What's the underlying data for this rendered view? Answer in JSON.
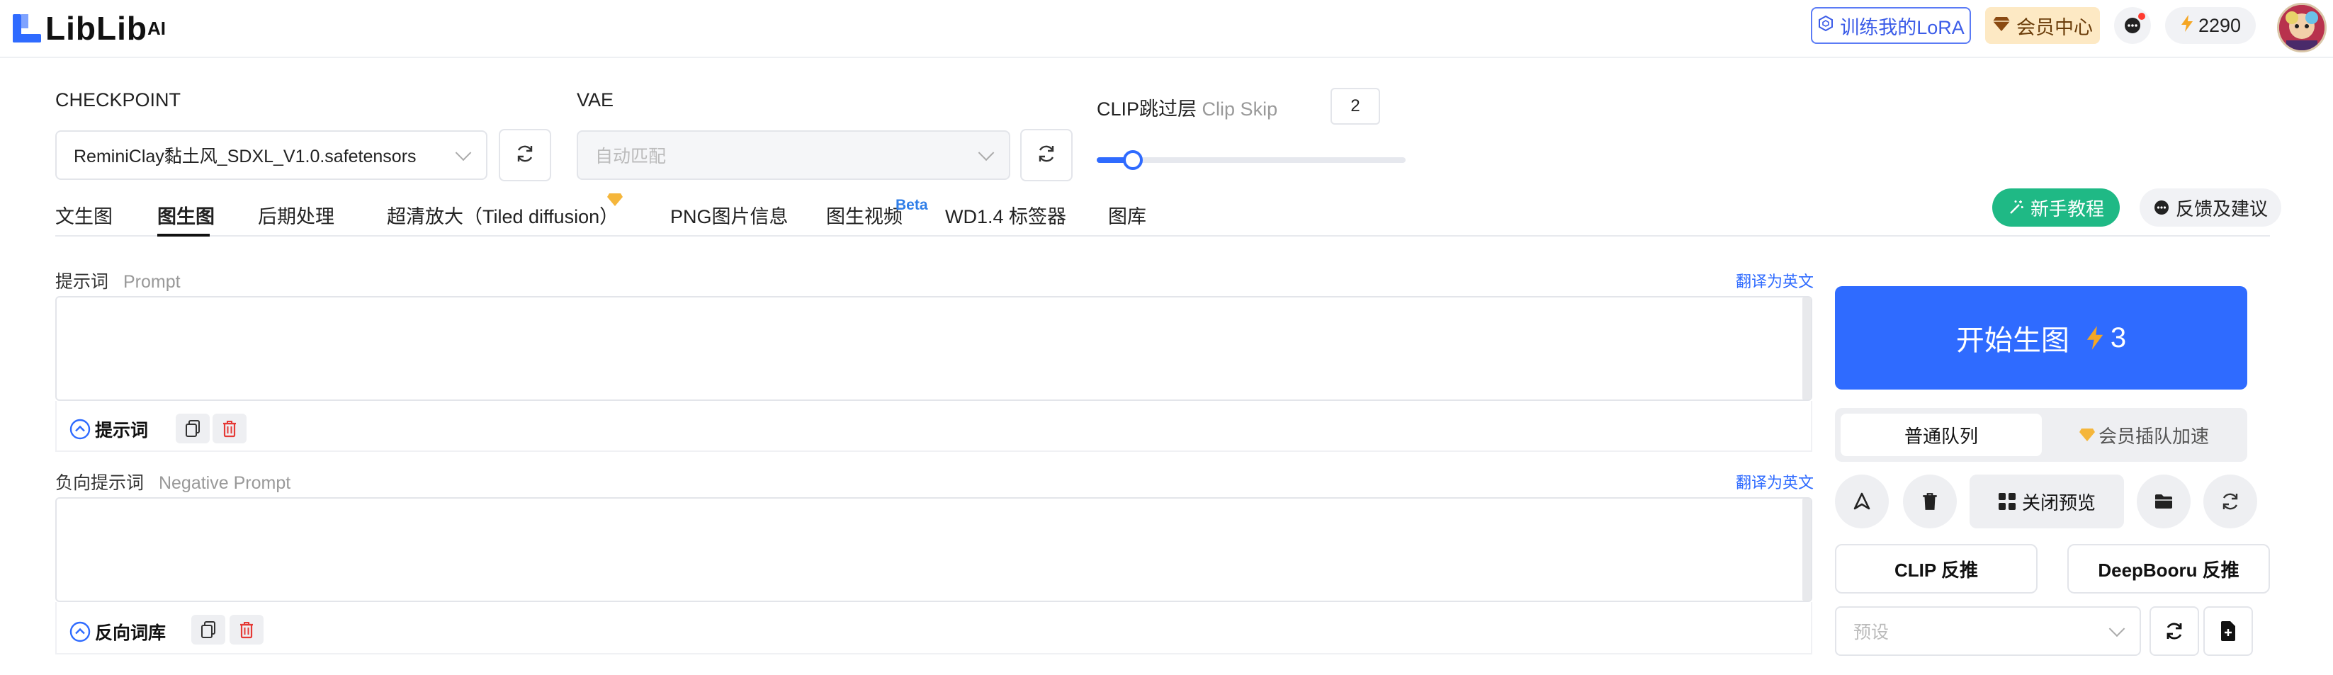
{
  "header": {
    "logo_text": "LibLib",
    "logo_sup": "AI",
    "train_lora": "训练我的LoRA",
    "vip_center": "会员中心",
    "credits": "2290"
  },
  "model": {
    "checkpoint_label": "CHECKPOINT",
    "checkpoint_value": "ReminiClay黏土风_SDXL_V1.0.safetensors",
    "vae_label": "VAE",
    "vae_value": "自动匹配",
    "clip_label": "CLIP跳过层",
    "clip_label_en": "Clip Skip",
    "clip_value": "2",
    "clip_min": 1,
    "clip_max": 12
  },
  "tabs": [
    {
      "label": "文生图"
    },
    {
      "label": "图生图",
      "active": true
    },
    {
      "label": "后期处理"
    },
    {
      "label": "超清放大（Tiled diffusion）"
    },
    {
      "label": "PNG图片信息"
    },
    {
      "label": "图生视频",
      "badge": "Beta"
    },
    {
      "label": "WD1.4 标签器"
    },
    {
      "label": "图库"
    }
  ],
  "actions": {
    "tutorial": "新手教程",
    "feedback": "反馈及建议"
  },
  "prompt": {
    "label": "提示词",
    "label_en": "Prompt",
    "translate": "翻译为英文",
    "value": "",
    "toggle_label": "提示词"
  },
  "negative": {
    "label": "负向提示词",
    "label_en": "Negative Prompt",
    "translate": "翻译为英文",
    "value": "",
    "toggle_label": "反向词库"
  },
  "generate": {
    "label": "开始生图",
    "cost": "3"
  },
  "queue": {
    "normal": "普通队列",
    "vip": "会员插队加速"
  },
  "tools": {
    "close_preview": "关闭预览",
    "clip_interrogate": "CLIP 反推",
    "deepbooru": "DeepBooru 反推",
    "preset_placeholder": "预设"
  },
  "colors": {
    "accent": "#2f6bff",
    "tutorial_green": "#1fb985",
    "vip_bg": "#fde9c4",
    "delete_red": "#e53935",
    "bolt": "#f5a623"
  }
}
